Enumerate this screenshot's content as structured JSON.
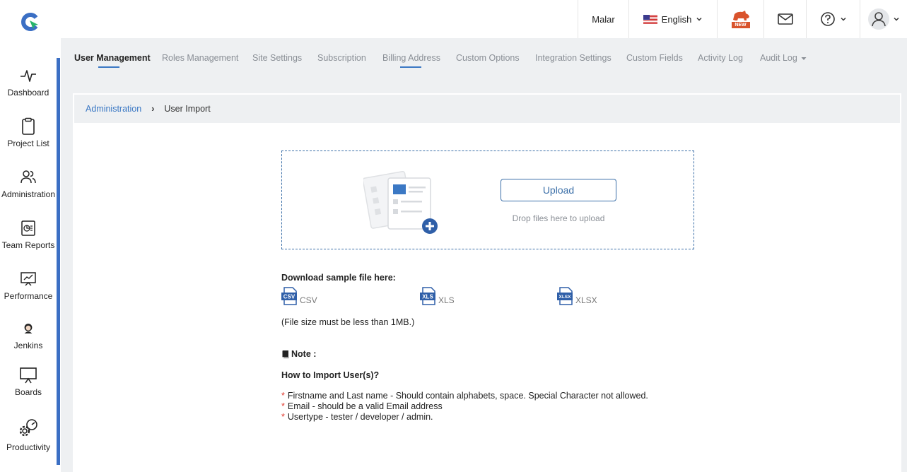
{
  "topbar": {
    "user_name": "Malar",
    "language": "English",
    "new_badge": "NEW"
  },
  "sidebar": {
    "items": [
      {
        "label": "Dashboard",
        "icon": "pulse-icon"
      },
      {
        "label": "Project List",
        "icon": "clipboard-icon"
      },
      {
        "label": "Administration",
        "icon": "users-icon"
      },
      {
        "label": "Team Reports",
        "icon": "report-icon"
      },
      {
        "label": "Performance",
        "icon": "performance-icon"
      },
      {
        "label": "Jenkins",
        "icon": "jenkins-icon"
      },
      {
        "label": "Boards",
        "icon": "board-icon"
      },
      {
        "label": "Productivity",
        "icon": "gears-icon"
      }
    ]
  },
  "tabs": [
    {
      "label": "User Management",
      "active": true
    },
    {
      "label": "Roles Management",
      "active": false
    },
    {
      "label": "Site Settings",
      "active": false
    },
    {
      "label": "Subscription",
      "active": false
    },
    {
      "label": "Billing Address",
      "active": false
    },
    {
      "label": "Custom Options",
      "active": false
    },
    {
      "label": "Integration Settings",
      "active": false
    },
    {
      "label": "Custom Fields",
      "active": false
    },
    {
      "label": "Activity Log",
      "active": false
    },
    {
      "label": "Audit Log",
      "active": false
    }
  ],
  "breadcrumb": {
    "parent": "Administration",
    "separator": "›",
    "current": "User Import"
  },
  "upload": {
    "button_label": "Upload",
    "hint": "Drop files here to upload"
  },
  "download": {
    "title": "Download sample file here:",
    "files": [
      {
        "badge": "CSV",
        "label": "CSV"
      },
      {
        "badge": "XLS",
        "label": "XLS"
      },
      {
        "badge": "XLSX",
        "label": "XLSX"
      }
    ],
    "size_note": "(File size must be less than 1MB.)"
  },
  "note": {
    "title": "Note :",
    "howto_title": "How to Import User(s)?",
    "rules": [
      "Firstname and Last name - Should contain alphabets, space. Special Character not allowed.",
      "Email - should be a valid Email address",
      "Usertype - tester / developer / admin."
    ]
  },
  "colors": {
    "accent": "#3b78c4",
    "sidebar_stripe": "#3b6fc4",
    "required_star": "#e03b2f",
    "new_badge": "#d9532c"
  }
}
